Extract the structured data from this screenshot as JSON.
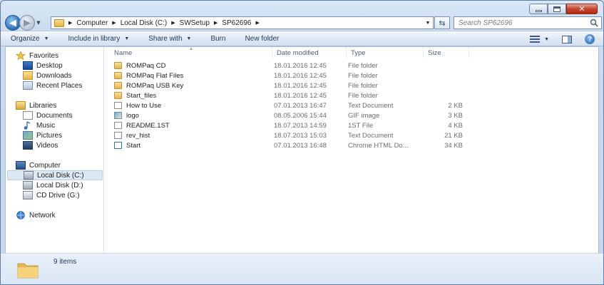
{
  "window": {
    "caption_buttons": [
      "minimize",
      "maximize",
      "close"
    ]
  },
  "address_bar": {
    "crumbs": [
      "Computer",
      "Local Disk (C:)",
      "SWSetup",
      "SP62696"
    ]
  },
  "search": {
    "placeholder": "Search SP62696"
  },
  "toolbar": {
    "organize": "Organize",
    "include_in_library": "Include in library",
    "share_with": "Share with",
    "burn": "Burn",
    "new_folder": "New folder"
  },
  "nav_pane": {
    "favorites": {
      "label": "Favorites",
      "items": [
        "Desktop",
        "Downloads",
        "Recent Places"
      ]
    },
    "libraries": {
      "label": "Libraries",
      "items": [
        "Documents",
        "Music",
        "Pictures",
        "Videos"
      ]
    },
    "computer": {
      "label": "Computer",
      "items": [
        "Local Disk (C:)",
        "Local Disk (D:)",
        "CD Drive (G:)"
      ],
      "selected": "Local Disk (C:)"
    },
    "network": {
      "label": "Network"
    }
  },
  "columns": {
    "name": "Name",
    "date": "Date modified",
    "type": "Type",
    "size": "Size"
  },
  "files": [
    {
      "name": "ROMPaq CD",
      "date": "18.01.2016 12:45",
      "type": "File folder",
      "size": "",
      "icon": "folder-icon"
    },
    {
      "name": "ROMPaq Flat Files",
      "date": "18.01.2016 12:45",
      "type": "File folder",
      "size": "",
      "icon": "folder-icon"
    },
    {
      "name": "ROMPaq USB Key",
      "date": "18.01.2016 12:45",
      "type": "File folder",
      "size": "",
      "icon": "folder-icon"
    },
    {
      "name": "Start_files",
      "date": "18.01.2016 12:45",
      "type": "File folder",
      "size": "",
      "icon": "folder-icon"
    },
    {
      "name": "How to Use",
      "date": "07.01.2013 16:47",
      "type": "Text Document",
      "size": "2 KB",
      "icon": "text-document-icon"
    },
    {
      "name": "logo",
      "date": "08.05.2006 15:44",
      "type": "GIF image",
      "size": "3 KB",
      "icon": "image-icon"
    },
    {
      "name": "README.1ST",
      "date": "18.07.2013 14:59",
      "type": "1ST File",
      "size": "4 KB",
      "icon": "file-icon"
    },
    {
      "name": "rev_hist",
      "date": "18.07.2013 15:03",
      "type": "Text Document",
      "size": "21 KB",
      "icon": "text-document-icon"
    },
    {
      "name": "Start",
      "date": "07.01.2013 16:48",
      "type": "Chrome HTML Do...",
      "size": "34 KB",
      "icon": "chrome-html-icon"
    }
  ],
  "status": {
    "item_count": "9 items"
  },
  "colors": {
    "chrome_bg": "#cfe0f1",
    "toolbar_text": "#1e395b",
    "close_button": "#c8432b",
    "selection": "#dde8f5"
  }
}
